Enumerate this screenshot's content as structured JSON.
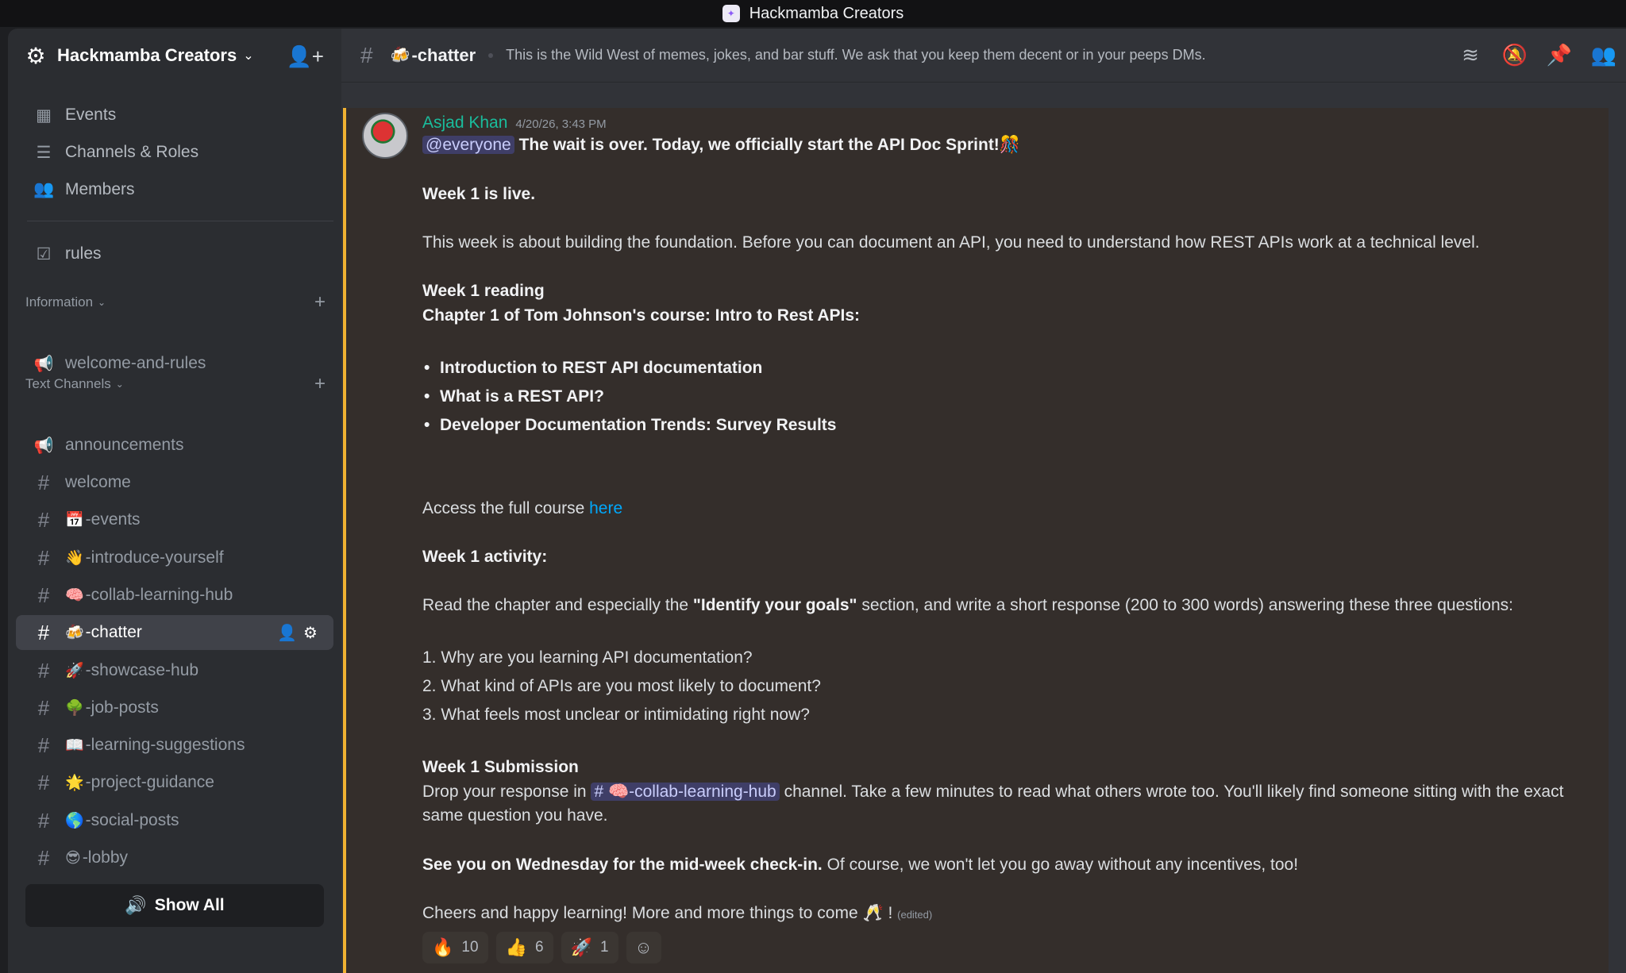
{
  "window": {
    "title": "Hackmamba Creators"
  },
  "server": {
    "name": "Hackmamba Creators"
  },
  "nav": {
    "events": "Events",
    "channels_roles": "Channels & Roles",
    "members": "Members",
    "rules": "rules"
  },
  "categories": {
    "information": "Information",
    "text_channels": "Text Channels"
  },
  "channels": {
    "welcome_and_rules": "welcome-and-rules",
    "announcements": "announcements",
    "list": [
      {
        "emoji": "",
        "label": "welcome"
      },
      {
        "emoji": "📅",
        "label": "-events"
      },
      {
        "emoji": "👋",
        "label": "-introduce-yourself"
      },
      {
        "emoji": "🧠",
        "label": "-collab-learning-hub"
      },
      {
        "emoji": "🍻",
        "label": "-chatter"
      },
      {
        "emoji": "🚀",
        "label": "-showcase-hub"
      },
      {
        "emoji": "🌳",
        "label": "-job-posts"
      },
      {
        "emoji": "📖",
        "label": "-learning-suggestions"
      },
      {
        "emoji": "🌟",
        "label": "-project-guidance"
      },
      {
        "emoji": "🌎",
        "label": "-social-posts"
      },
      {
        "emoji": "😎",
        "label": "-lobby"
      }
    ],
    "active_index": 4,
    "show_all": "Show All"
  },
  "header": {
    "channel_emoji": "🍻",
    "channel_name": "-chatter",
    "topic": "This is the Wild West of memes, jokes, and bar stuff. We ask that you keep them decent or in your peeps DMs."
  },
  "message": {
    "author": "Asjad Khan",
    "timestamp": "4/20/26, 3:43 PM",
    "mention": "@everyone",
    "headline": "The wait is over. Today, we officially start the API Doc Sprint!🎊",
    "week_live": "Week 1 is live.",
    "intro": "This week is about building the foundation. Before you can document an API, you need to understand how REST APIs work at a technical level.",
    "reading_title": "Week 1 reading",
    "reading_sub": "Chapter 1 of Tom Johnson's course: Intro to Rest APIs:",
    "reading_items": [
      "Introduction to REST API documentation",
      "What is a REST API?",
      "Developer Documentation Trends: Survey Results"
    ],
    "access_text": "Access the full course ",
    "access_link": "here",
    "activity_title": "Week 1 activity:",
    "activity_pre": "Read the chapter and especially the ",
    "activity_bold": "\"Identify your goals\"",
    "activity_post": " section, and write a short response (200 to 300 words) answering these three questions:",
    "questions": [
      "1. Why are you learning API documentation?",
      "2. What kind of APIs are you most likely to document?",
      "3. What feels most unclear or intimidating right now?"
    ],
    "submission_title": "Week 1 Submission",
    "submission_pre": "Drop your response in ",
    "submission_channel": "# 🧠-collab-learning-hub",
    "submission_post": " channel. Take a few minutes to read what others wrote too. You'll likely find someone sitting with the exact same question you have.",
    "see_you_bold": "See you on Wednesday for the mid-week check-in.",
    "see_you_rest": " Of course, we won't let you go away without any incentives, too!",
    "cheers": "Cheers and happy learning! More and more things to come 🥂 !",
    "edited": "(edited)",
    "reactions": [
      {
        "emoji": "🔥",
        "count": "10"
      },
      {
        "emoji": "👍",
        "count": "6"
      },
      {
        "emoji": "🚀",
        "count": "1"
      }
    ]
  },
  "colors": {
    "accent_bar": "#f0b232",
    "author": "#1abc9c",
    "link": "#00a8fc"
  }
}
